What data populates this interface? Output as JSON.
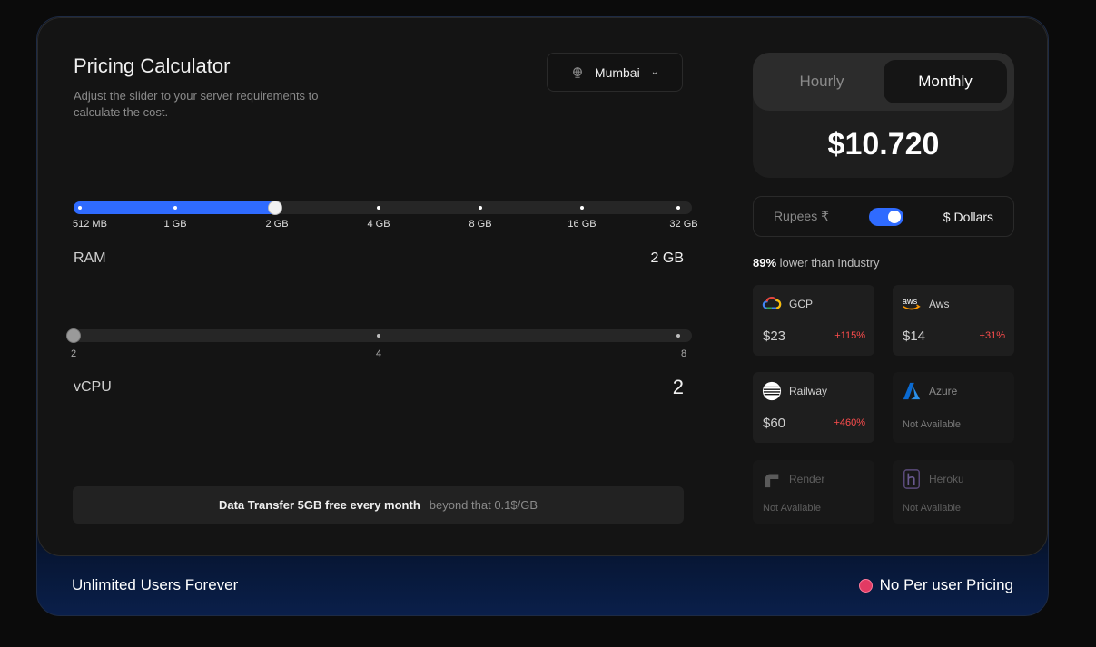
{
  "header": {
    "title": "Pricing Calculator",
    "subtitle": "Adjust the slider to your server requirements to calculate the cost.",
    "region": "Mumbai"
  },
  "ram": {
    "label": "RAM",
    "value": "2 GB",
    "ticks": [
      "512 MB",
      "1 GB",
      "2 GB",
      "4 GB",
      "8 GB",
      "16 GB",
      "32 GB"
    ],
    "selected_index": 2
  },
  "vcpu": {
    "label": "vCPU",
    "value": "2",
    "ticks": [
      "2",
      "4",
      "8"
    ],
    "selected_index": 0
  },
  "transfer": {
    "bold": "Data Transfer 5GB free every month",
    "note": "beyond that 0.1$/GB"
  },
  "billing": {
    "tabs": [
      "Hourly",
      "Monthly"
    ],
    "active_tab": "Monthly",
    "price": "$10.720"
  },
  "currency": {
    "left": "Rupees ₹",
    "right": "$ Dollars",
    "selected": "Dollars"
  },
  "comparison": {
    "percent": "89%",
    "text": "lower than Industry"
  },
  "providers": [
    {
      "name": "GCP",
      "price": "$23",
      "change": "+115%",
      "icon": "gcp-icon"
    },
    {
      "name": "Aws",
      "price": "$14",
      "change": "+31%",
      "icon": "aws-icon"
    },
    {
      "name": "Railway",
      "price": "$60",
      "change": "+460%",
      "icon": "railway-icon"
    },
    {
      "name": "Azure",
      "status": "Not Available",
      "icon": "azure-icon"
    },
    {
      "name": "Render",
      "status": "Not Available",
      "icon": "render-icon"
    },
    {
      "name": "Heroku",
      "status": "Not Available",
      "icon": "heroku-icon"
    }
  ],
  "footer": {
    "left": "Unlimited Users Forever",
    "right": "No Per user Pricing"
  },
  "colors": {
    "accent": "#2f6bff",
    "increase": "#ff4d4d",
    "badge": "#e23a63"
  }
}
